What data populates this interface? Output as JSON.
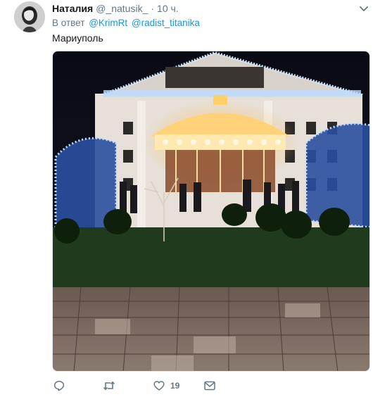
{
  "tweet": {
    "author_name": "Наталия",
    "author_handle": "@_natusik_",
    "separator": "·",
    "time": "10 ч.",
    "reply_prefix": "В ответ",
    "mentions": [
      "@KrimRt",
      "@radist_titanika"
    ],
    "text": "Мариуполь",
    "actions": {
      "reply_icon": "reply-icon",
      "retweet_icon": "retweet-icon",
      "like_icon": "heart-icon",
      "like_count": "19",
      "dm_icon": "envelope-icon"
    }
  },
  "colors": {
    "link": "#1b95e0",
    "secondary_text": "#657786",
    "primary_text": "#14171a"
  }
}
